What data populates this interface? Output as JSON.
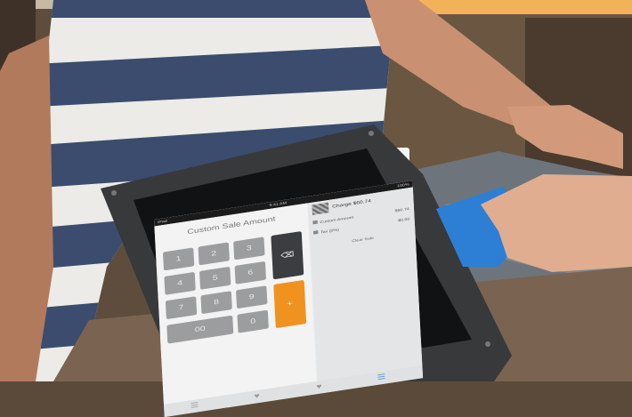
{
  "scene": {
    "background_color": "#5b4a3a",
    "shirt_white": "#ecebe7",
    "shirt_navy": "#3b4c6e",
    "skin": "#c99072",
    "card_color": "#2c7fd4",
    "stand_color": "#38393b",
    "orange_banner": "#f1b25a"
  },
  "top_banner": {
    "text_left": "",
    "text_right": ""
  },
  "app": {
    "status_left": "iPad",
    "status_time": "9:41 AM",
    "status_right": "100%",
    "panel_title": "Custom Sale Amount",
    "keys": [
      "1",
      "2",
      "3",
      "4",
      "5",
      "6",
      "7",
      "8",
      "9",
      "00",
      "0"
    ],
    "clear_key": "⌫",
    "plus_key": "+",
    "charge_label": "Charge $60.74",
    "rows": [
      {
        "label": "Custom Amount",
        "value": "$60.74"
      },
      {
        "label": "Tax (0%)",
        "value": "$0.00"
      }
    ],
    "clear_sale": "Clear Sale",
    "tab_icons": [
      "list-icon",
      "tag-icon",
      "heart-icon",
      "grid-icon"
    ]
  }
}
